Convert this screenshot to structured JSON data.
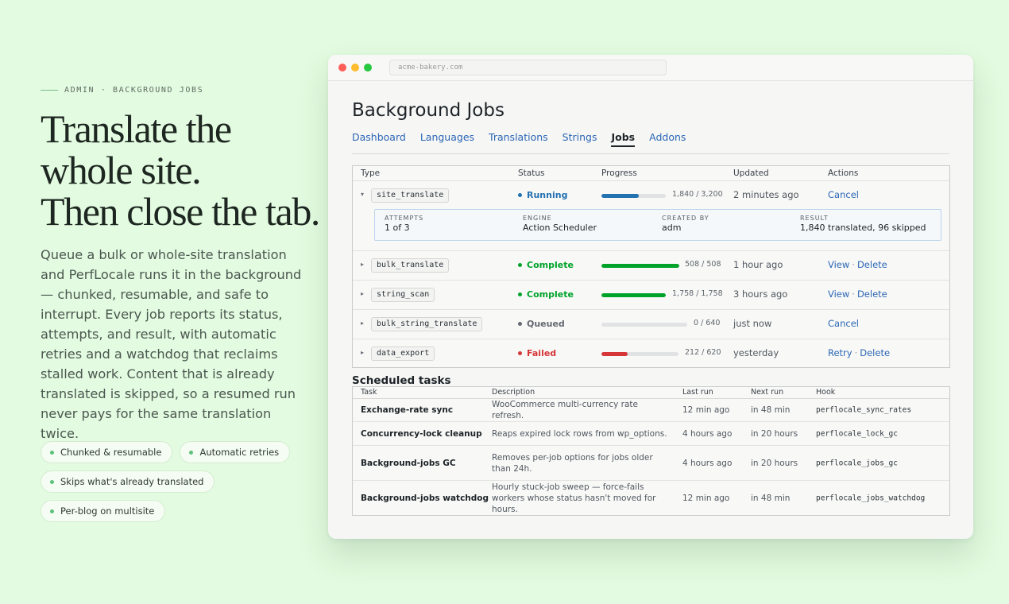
{
  "hero": {
    "eyebrow": "ADMIN · BACKGROUND JOBS",
    "headline": [
      "Translate the",
      "whole site.",
      "Then close the tab."
    ],
    "lede": "Queue a bulk or whole-site translation and PerfLocale runs it in the background — chunked, resumable, and safe to interrupt. Every job reports its status, attempts, and result, with automatic retries and a watchdog that reclaims stalled work. Content that is already translated is skipped, so a resumed run never pays for the same translation twice.",
    "chips": [
      "Chunked & resumable",
      "Automatic retries",
      "Skips what's already translated",
      "Per-blog on multisite"
    ]
  },
  "browser": {
    "url": "acme-bakery.com",
    "traffic_lights": [
      "#ff5f57",
      "#febc2e",
      "#28c840"
    ]
  },
  "page": {
    "title": "Background Jobs",
    "tabs": [
      {
        "label": "Dashboard",
        "active": false
      },
      {
        "label": "Languages",
        "active": false
      },
      {
        "label": "Translations",
        "active": false
      },
      {
        "label": "Strings",
        "active": false
      },
      {
        "label": "Jobs",
        "active": true
      },
      {
        "label": "Addons",
        "active": false
      }
    ]
  },
  "jobs": {
    "headers": [
      "Type",
      "Status",
      "Progress",
      "Updated",
      "Actions"
    ],
    "rows": [
      {
        "type": "site_translate",
        "caret": "▾",
        "status": "Running",
        "status_color": "#2271b1",
        "progress_fraction": 0.575,
        "progress_text": "1,840 / 3,200",
        "updated": "2 minutes ago",
        "actions": [
          "Cancel"
        ]
      },
      {
        "type": "bulk_translate",
        "caret": "▸",
        "status": "Complete",
        "status_color": "#00a32a",
        "progress_fraction": 1.0,
        "progress_text": "508 / 508",
        "updated": "1 hour ago",
        "actions": [
          "View",
          "Delete"
        ]
      },
      {
        "type": "string_scan",
        "caret": "▸",
        "status": "Complete",
        "status_color": "#00a32a",
        "progress_fraction": 1.0,
        "progress_text": "1,758 / 1,758",
        "updated": "3 hours ago",
        "actions": [
          "View",
          "Delete"
        ]
      },
      {
        "type": "bulk_string_translate",
        "caret": "▸",
        "status": "Queued",
        "status_color": "#646970",
        "progress_fraction": 0.0,
        "progress_text": "0 / 640",
        "updated": "just now",
        "actions": [
          "Cancel"
        ]
      },
      {
        "type": "data_export",
        "caret": "▸",
        "status": "Failed",
        "status_color": "#d63638",
        "progress_fraction": 0.34,
        "progress_text": "212 / 620",
        "updated": "yesterday",
        "actions": [
          "Retry",
          "Delete"
        ]
      }
    ],
    "detail": [
      {
        "label": "ATTEMPTS",
        "value": "1 of 3"
      },
      {
        "label": "ENGINE",
        "value": "Action Scheduler"
      },
      {
        "label": "CREATED BY",
        "value": "adm"
      },
      {
        "label": "RESULT",
        "value": "1,840 translated, 96 skipped"
      }
    ]
  },
  "scheduled": {
    "title": "Scheduled tasks",
    "headers": [
      "Task",
      "Description",
      "Last run",
      "Next run",
      "Hook"
    ],
    "rows": [
      {
        "task": "Exchange-rate sync",
        "description": "WooCommerce multi-currency rate refresh.",
        "last_run": "12 min ago",
        "next_run": "in 48 min",
        "hook": "perflocale_sync_rates"
      },
      {
        "task": "Concurrency-lock cleanup",
        "description": "Reaps expired lock rows from wp_options.",
        "last_run": "4 hours ago",
        "next_run": "in 20 hours",
        "hook": "perflocale_lock_gc"
      },
      {
        "task": "Background-jobs GC",
        "description": "Removes per-job options for jobs older than 24h.",
        "last_run": "4 hours ago",
        "next_run": "in 20 hours",
        "hook": "perflocale_jobs_gc"
      },
      {
        "task": "Background-jobs watchdog",
        "description": "Hourly stuck-job sweep — force-fails workers whose status hasn't moved for hours.",
        "last_run": "12 min ago",
        "next_run": "in 48 min",
        "hook": "perflocale_jobs_watchdog"
      }
    ]
  }
}
